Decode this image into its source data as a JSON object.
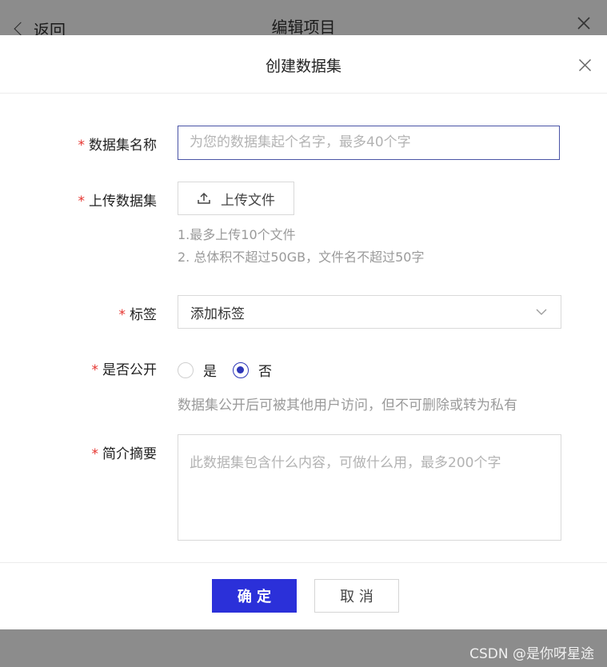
{
  "background": {
    "back_label": "返回",
    "page_title": "编辑项目",
    "watermark": "CSDN @是你呀星途"
  },
  "modal": {
    "title": "创建数据集",
    "fields": {
      "name": {
        "required_mark": "*",
        "label": "数据集名称",
        "value": "",
        "placeholder": "为您的数据集起个名字，最多40个字"
      },
      "upload": {
        "required_mark": "*",
        "label": "上传数据集",
        "button_label": "上传文件",
        "hint_1": "1.最多上传10个文件",
        "hint_2": "2. 总体积不超过50GB，文件名不超过50字"
      },
      "tags": {
        "required_mark": "*",
        "label": "标签",
        "selected": "添加标签"
      },
      "public": {
        "required_mark": "*",
        "label": "是否公开",
        "options": [
          "是",
          "否"
        ],
        "selected": "否",
        "hint": "数据集公开后可被其他用户访问，但不可删除或转为私有"
      },
      "summary": {
        "required_mark": "*",
        "label": "简介摘要",
        "value": "",
        "placeholder": "此数据集包含什么内容，可做什么用，最多200个字"
      }
    },
    "footer": {
      "confirm_label": "确 定",
      "cancel_label": "取 消"
    }
  },
  "colors": {
    "primary": "#2b30d9",
    "required": "#e5322d",
    "radio_checked": "#2d36b8",
    "overlay": "#8a8a8a"
  }
}
